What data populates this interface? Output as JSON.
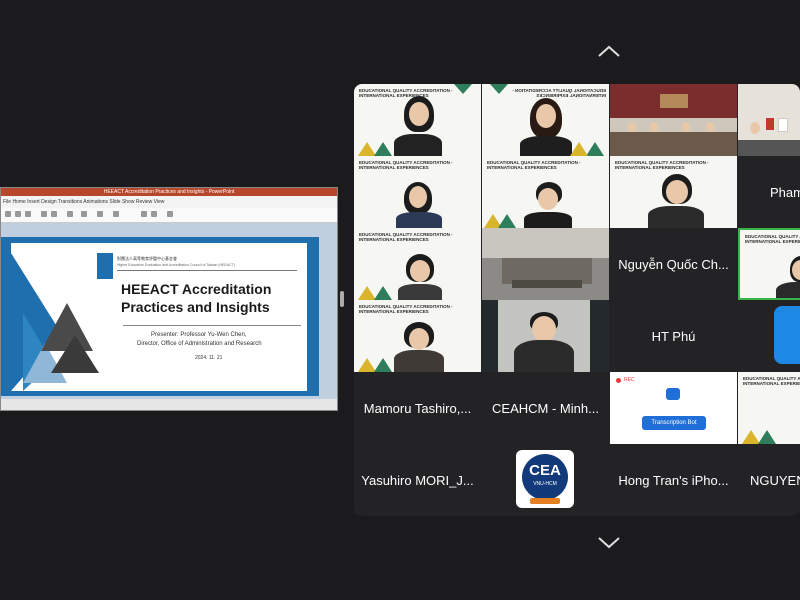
{
  "shared_screen": {
    "window_title": "HEEACT Accreditation Practices and Insights - PowerPoint",
    "ribbon_tabs": "File  Home  Insert  Design  Transitions  Animations  Slide Show  Review  View",
    "slide": {
      "year": "2024",
      "org_name_zh": "財團法人高等教育評鑑中心基金會",
      "org_name_en": "Higher Education Evaluation and Accreditation Council of Taiwan (HEEACT)",
      "title_line1": "HEEACT Accreditation",
      "title_line2": "Practices and Insights",
      "presenter": "Presenter: Professor Yu-Wen Chen,",
      "role": "Director, Office of Administration and Research",
      "date": "2024. 11. 21"
    }
  },
  "gallery": {
    "banner": "EDUCATIONAL QUALITY ACCREDITATION - INTERNATIONAL EXPERIENCES",
    "names": {
      "r1c4": "Pham",
      "r3c3": "Nguyễn Quốc Ch...",
      "r4c3": "HT Phú",
      "r5c1": "Mamoru Tashiro,...",
      "r5c2": "CEAHCM - Minh...",
      "r6c1": "Yasuhiro MORI_J...",
      "r6c3": "Hong Tran's iPho...",
      "r6c4": "NGUYEN"
    },
    "rec_label": "REC",
    "bot_label": "Transcription Bot",
    "cea_logo": "CEA",
    "cea_sub": "VNU-HCM"
  },
  "nav": {
    "up_icon": "chevron-up-icon",
    "down_icon": "chevron-down-icon"
  },
  "colors": {
    "accent_green": "#2e7d5b",
    "accent_yellow": "#d9b52c",
    "active_border": "#3bb54a",
    "slide_blue": "#1f6faf"
  }
}
